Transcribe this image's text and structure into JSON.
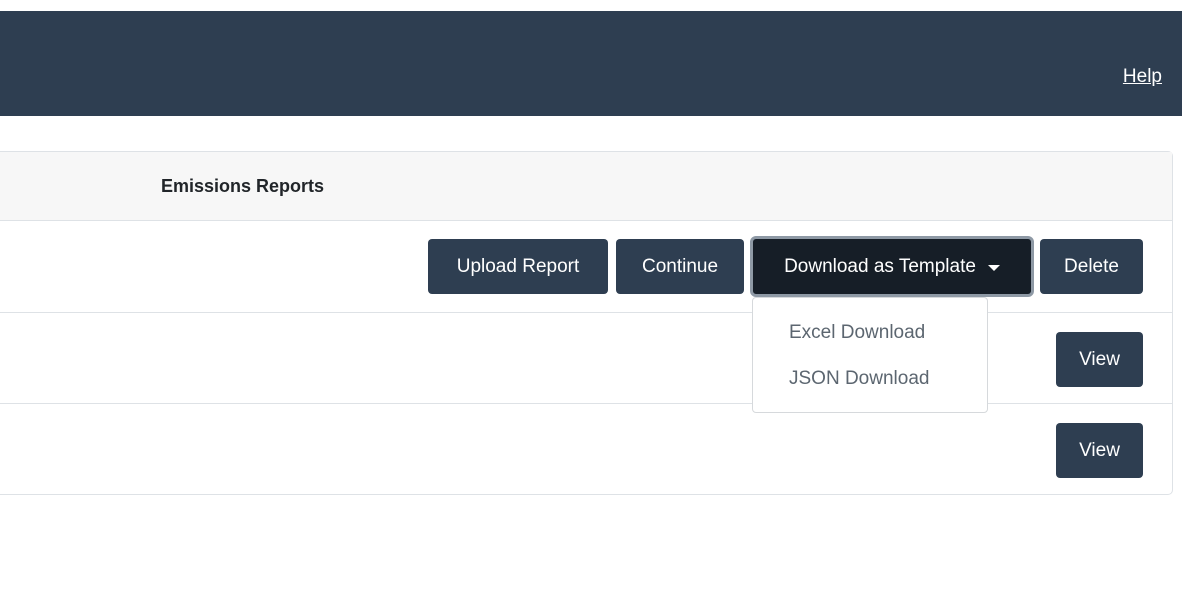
{
  "header": {
    "help_label": "Help",
    "background_color": "#2e3e51"
  },
  "table": {
    "header_title": "Emissions Reports",
    "rows": [
      {
        "actions": {
          "upload_label": "Upload Report",
          "continue_label": "Continue",
          "download_label": "Download as Template",
          "delete_label": "Delete"
        }
      },
      {
        "view_label": "View"
      },
      {
        "view_label": "View"
      }
    ]
  },
  "dropdown": {
    "items": [
      "Excel Download",
      "JSON Download"
    ]
  },
  "colors": {
    "button": "#2e3e51",
    "button_active": "#161e27",
    "dropdown_text": "#5c6670"
  }
}
